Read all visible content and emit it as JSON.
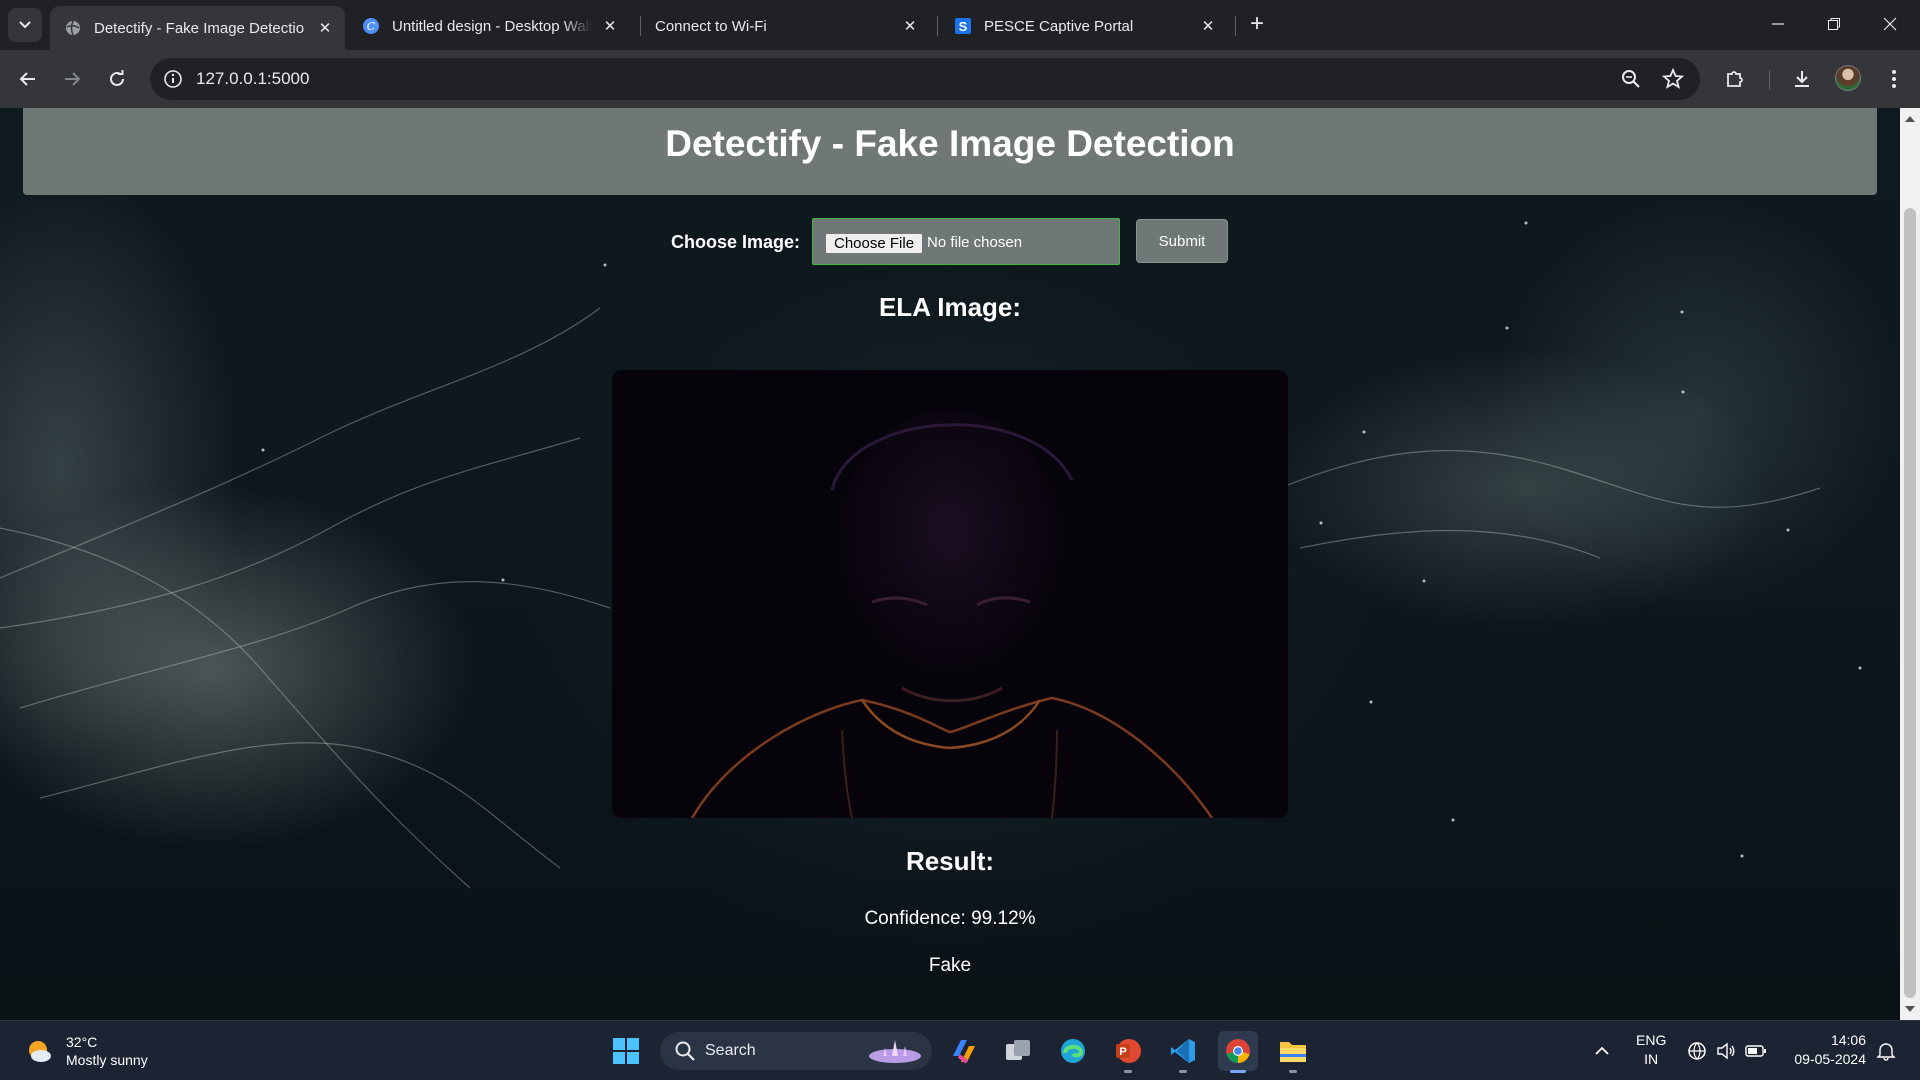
{
  "browser": {
    "tabs": [
      {
        "title": "Detectify - Fake Image Detectio",
        "icon": "globe-icon",
        "active": true
      },
      {
        "title": "Untitled design - Desktop Wallp",
        "icon": "canva-icon",
        "active": false
      },
      {
        "title": "Connect to Wi-Fi",
        "icon": "",
        "active": false
      },
      {
        "title": "PESCE Captive Portal",
        "icon": "s-logo-icon",
        "active": false
      }
    ],
    "url": "127.0.0.1:5000"
  },
  "page": {
    "header_title": "Detectify - Fake Image Detection",
    "choose_label": "Choose Image:",
    "file_button": "Choose File",
    "file_status": "No file chosen",
    "submit_label": "Submit",
    "ela_heading": "ELA Image:",
    "result_heading": "Result:",
    "confidence": "Confidence: 99.12%",
    "verdict": "Fake"
  },
  "taskbar": {
    "weather_temp": "32°C",
    "weather_desc": "Mostly sunny",
    "search_label": "Search",
    "lang_line1": "ENG",
    "lang_line2": "IN",
    "time": "14:06",
    "date": "09-05-2024"
  },
  "colors": {
    "accent_border": "#46b346",
    "header_bg": "#6f7877"
  }
}
